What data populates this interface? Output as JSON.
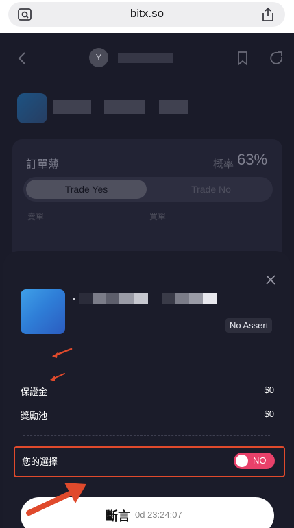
{
  "browser": {
    "url": "bitx.so",
    "left_icon": "reader-icon",
    "right_icon": "share-icon"
  },
  "header": {
    "avatar_letter": "Y",
    "back_icon": "chevron-left-icon",
    "bookmark_icon": "bookmark-icon",
    "share_icon": "share-icon"
  },
  "orderbook": {
    "title": "訂單薄",
    "probability_label": "概率",
    "probability_value": "63%",
    "tabs": [
      {
        "label": "Trade Yes",
        "active": true
      },
      {
        "label": "Trade No",
        "active": false
      }
    ],
    "columns": [
      "賣單",
      "買單"
    ]
  },
  "sheet": {
    "badge": "No Assert",
    "rows": [
      {
        "label": "保證金",
        "value": "$0"
      },
      {
        "label": "獎勵池",
        "value": "$0"
      }
    ],
    "choice": {
      "label": "您的選擇",
      "toggle_text": "NO"
    },
    "predict_button": {
      "label": "斷言",
      "countdown": "0d 23:24:07"
    }
  },
  "colors": {
    "accent_pink": "#e8416a",
    "annotation_red": "#e04a2c",
    "sheet_bg": "#1b1c2a"
  }
}
